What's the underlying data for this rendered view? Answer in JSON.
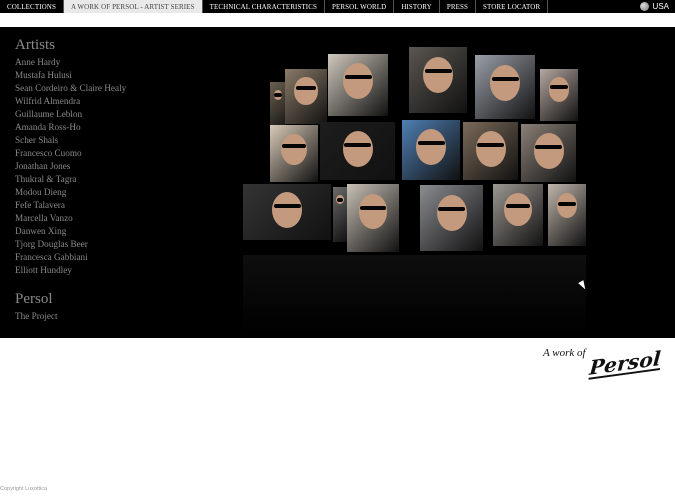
{
  "nav": {
    "items": [
      {
        "label": "COLLECTIONS",
        "active": false
      },
      {
        "label": "A WORK OF PERSOL - ARTIST SERIES",
        "active": true
      },
      {
        "label": "TECHNICAL CHARACTERISTICS",
        "active": false
      },
      {
        "label": "PERSOL WORLD",
        "active": false
      },
      {
        "label": "HISTORY",
        "active": false
      },
      {
        "label": "PRESS",
        "active": false
      },
      {
        "label": "STORE LOCATOR",
        "active": false
      }
    ],
    "region_icon": "globe-icon",
    "region": "USA"
  },
  "sidebar": {
    "artists_title": "Artists",
    "artists": [
      "Anne Hardy",
      "Mustafa Hulusi",
      "Sean Cordeiro & Claire Healy",
      "Wilfrid Almendra",
      "Guillaume Leblon",
      "Amanda Ross-Ho",
      "Scher Shals",
      "Francesco Cuomo",
      "Jonathan Jones",
      "Thukral & Tagra",
      "Modou Dieng",
      "Fefe Talavera",
      "Marcella Vanzo",
      "Danwen Xing",
      "Tjorg Douglas Beer",
      "Francesca Gabbiani",
      "Elliott Hundley"
    ],
    "persol_title": "Persol",
    "persol_items": [
      "The Project"
    ]
  },
  "logo": {
    "tagline": "A work of",
    "brand": "Persol"
  },
  "footer": {
    "copyright": "Copyright Luxottica"
  },
  "colors": {
    "stage": "#000000",
    "nav_bg": "#000000",
    "active_tab": "#e9e9e9",
    "sidebar_text": "#8a8a8a"
  }
}
